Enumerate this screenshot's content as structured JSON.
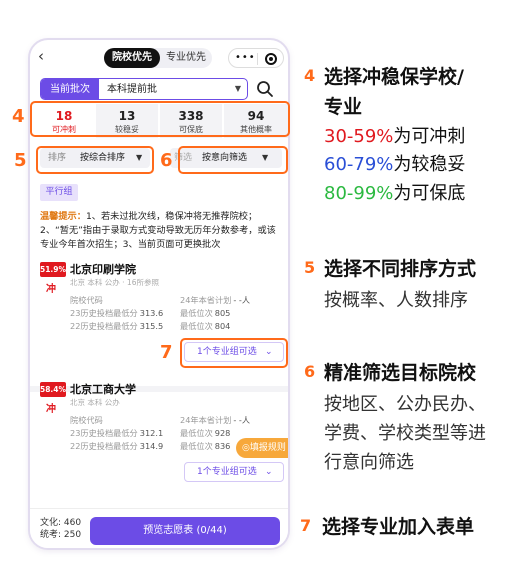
{
  "topbar": {
    "back": "‹",
    "seg_a": "院校优先",
    "seg_b": "专业优先",
    "capsule_dots": "•••"
  },
  "batch": {
    "label": "当前批次",
    "value": "本科提前批"
  },
  "tabs": [
    {
      "num": "18",
      "label": "可冲刺"
    },
    {
      "num": "13",
      "label": "较稳妥"
    },
    {
      "num": "338",
      "label": "可保底"
    },
    {
      "num": "94",
      "label": "其他概率"
    }
  ],
  "filters": [
    {
      "key": "排序",
      "value": "按综合排序"
    },
    {
      "key": "筛选",
      "value": "按意向筛选"
    }
  ],
  "pinghang": "平行组",
  "tip": {
    "label": "温馨提示：",
    "text": "1、若未过批次线，稳保冲将无推荐院校；2、“暂无”指由于录取方式变动导致无历年分数参考，或该专业今年首次招生；3、当前页面可更换批次"
  },
  "schools": [
    {
      "prob": "51.9%",
      "tag": "冲",
      "name": "北京印刷学院",
      "meta": "北京 本科 公办 · 16所参照",
      "left": [
        {
          "k": "院校代码",
          "v": ""
        },
        {
          "k": "23历史投档最低分",
          "v": "313.6"
        },
        {
          "k": "22历史投档最低分",
          "v": "315.5"
        }
      ],
      "right": [
        {
          "k": "24年本省计划",
          "v": "- -人"
        },
        {
          "k": "最低位次",
          "v": "805"
        },
        {
          "k": "最低位次",
          "v": "804"
        }
      ],
      "major_btn": "1个专业组可选"
    },
    {
      "prob": "58.4%",
      "tag": "冲",
      "name": "北京工商大学",
      "meta": "北京 本科 公办",
      "left": [
        {
          "k": "院校代码",
          "v": ""
        },
        {
          "k": "23历史投档最低分",
          "v": "312.1"
        },
        {
          "k": "22历史投档最低分",
          "v": "314.9"
        }
      ],
      "right": [
        {
          "k": "24年本省计划",
          "v": "- -人"
        },
        {
          "k": "最低位次",
          "v": "928"
        },
        {
          "k": "最低位次",
          "v": "836"
        }
      ],
      "major_btn": "1个专业组可选"
    }
  ],
  "fill_btn": "◎填报规则",
  "bottom": {
    "stat1": "文化: 460",
    "stat2": "统考: 250",
    "preview": "预览志愿表  (0/44)"
  },
  "markers": [
    "4",
    "5",
    "6",
    "7"
  ],
  "annotations": {
    "a4": {
      "num": "4",
      "t1": "选择冲稳保学校/",
      "t2": "专业",
      "l1_pct": "30-59%",
      "l1_suf": "为可冲刺",
      "l2_pct": "60-79%",
      "l2_suf": "为较稳妥",
      "l3_pct": "80-99%",
      "l3_suf": "为可保底"
    },
    "a5": {
      "num": "5",
      "title": "选择不同排序方式",
      "desc": "按概率、人数排序"
    },
    "a6": {
      "num": "6",
      "title": "精准筛选目标院校",
      "d1": "按地区、公办民办、",
      "d2": "学费、学校类型等进",
      "d3": "行意向筛选"
    },
    "a7": {
      "num": "7",
      "title": "选择专业加入表单"
    }
  },
  "colors": {
    "accent": "#6c4ce6",
    "highlight": "#ff6a1a",
    "red": "#e0191f",
    "blue": "#2a4fd6",
    "green": "#2bb940"
  }
}
